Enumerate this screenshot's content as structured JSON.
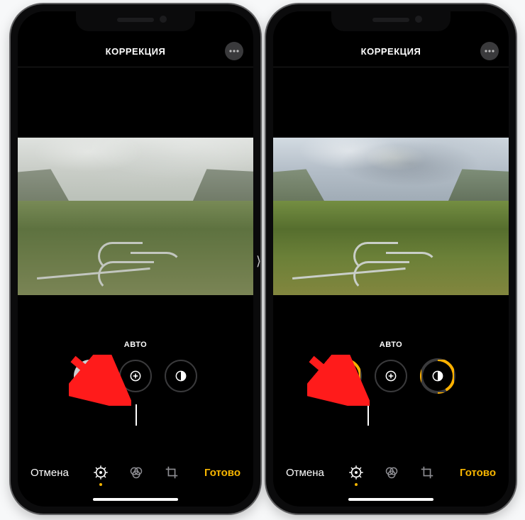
{
  "left": {
    "header": {
      "title": "КОРРЕКЦИЯ"
    },
    "tool_label": "АВТО",
    "slider": {
      "marker_position_pct": 50
    },
    "bottombar": {
      "cancel": "Отмена",
      "done": "Готово"
    },
    "dials": {
      "auto_wand": "magic-wand-icon",
      "exposure": "exposure-icon",
      "contrast": "contrast-icon"
    }
  },
  "right": {
    "header": {
      "title": "КОРРЕКЦИЯ"
    },
    "tool_label": "АВТО",
    "slider": {
      "marker_position_pct": 39
    },
    "bottombar": {
      "cancel": "Отмена",
      "done": "Готово"
    },
    "dials": {
      "auto_wand": "magic-wand-icon",
      "exposure": "exposure-icon",
      "contrast": "contrast-icon"
    }
  },
  "colors": {
    "accent": "#f7b500",
    "arrow": "#ff1b1b"
  }
}
